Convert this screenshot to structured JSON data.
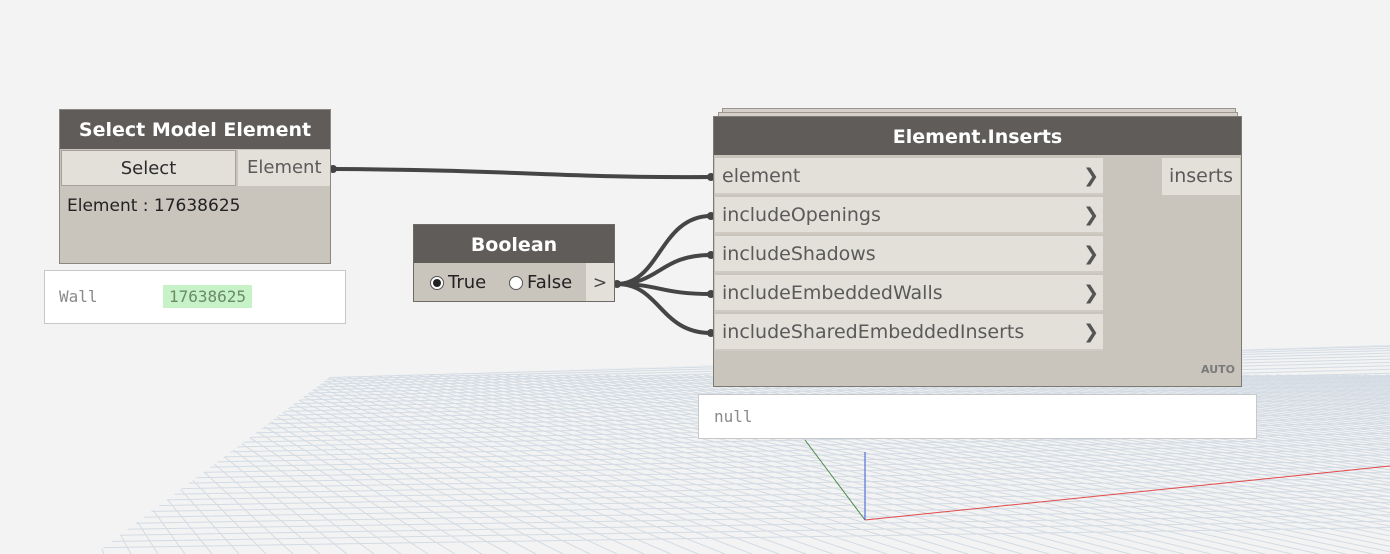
{
  "nodes": {
    "select_model_element": {
      "title": "Select Model Element",
      "select_button_label": "Select",
      "output_port_label": "Element",
      "status_text": "Element : 17638625",
      "preview": {
        "type": "Wall",
        "value": "17638625"
      }
    },
    "boolean": {
      "title": "Boolean",
      "options": [
        {
          "label": "True",
          "selected": true
        },
        {
          "label": "False",
          "selected": false
        }
      ],
      "output_port_label": ">"
    },
    "element_inserts": {
      "title": "Element.Inserts",
      "inputs": [
        {
          "label": "element"
        },
        {
          "label": "includeOpenings"
        },
        {
          "label": "includeShadows"
        },
        {
          "label": "includeEmbeddedWalls"
        },
        {
          "label": "includeSharedEmbeddedInserts"
        }
      ],
      "output_port_label": "inserts",
      "lacing_label": "AUTO",
      "preview": {
        "value": "null"
      }
    }
  },
  "colors": {
    "canvas": "#f3f3f3",
    "node_header": "#5f5c59",
    "node_body": "#c9c4bc",
    "port": "#e3e0da",
    "wire": "#454545",
    "grid": "#d3dbe4",
    "axis_x": "#e24a4a",
    "axis_y": "#4a8a4a",
    "axis_z": "#3a5ad6",
    "preview_highlight": "#c7f2c7"
  },
  "icons": {
    "port_chevron": "chevron-right-icon"
  }
}
